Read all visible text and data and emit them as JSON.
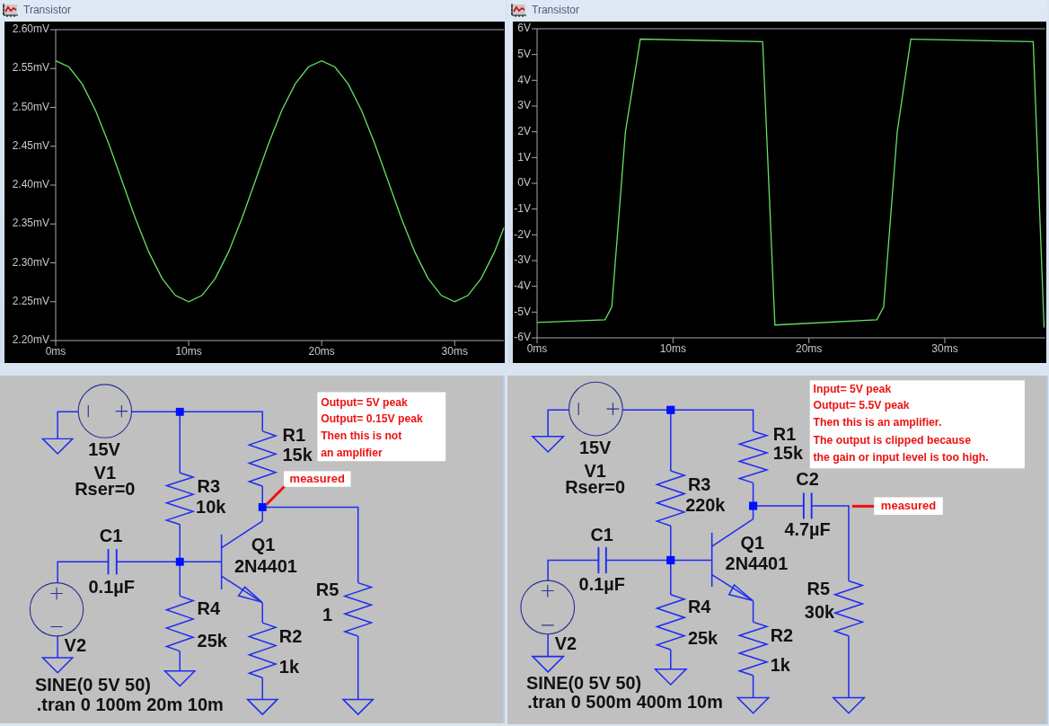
{
  "plot_windows": [
    {
      "title": "Transistor",
      "chart_data": {
        "type": "line",
        "x": [
          0,
          1,
          2,
          3,
          4,
          5,
          6,
          7,
          8,
          9,
          10,
          11,
          12,
          13,
          14,
          15,
          16,
          17,
          18,
          19,
          20,
          21,
          22,
          23,
          24,
          25,
          26,
          27,
          28,
          29,
          30,
          31,
          32,
          33,
          33.7
        ],
        "series": [
          {
            "color": "#66e066",
            "values": [
              2.56,
              2.552,
              2.53,
              2.496,
              2.453,
              2.405,
              2.357,
              2.314,
              2.28,
              2.258,
              2.25,
              2.258,
              2.28,
              2.314,
              2.357,
              2.405,
              2.453,
              2.496,
              2.53,
              2.552,
              2.56,
              2.552,
              2.53,
              2.496,
              2.453,
              2.405,
              2.357,
              2.314,
              2.28,
              2.258,
              2.25,
              2.258,
              2.28,
              2.314,
              2.345
            ]
          }
        ],
        "xlim": [
          0,
          33.7
        ],
        "ylim": [
          2.2,
          2.6
        ],
        "xticks": [
          {
            "value": 0,
            "label": "0ms"
          },
          {
            "value": 10,
            "label": "10ms"
          },
          {
            "value": 20,
            "label": "20ms"
          },
          {
            "value": 30,
            "label": "30ms"
          }
        ],
        "yticks": [
          {
            "value": 2.2,
            "label": "2.20mV"
          },
          {
            "value": 2.25,
            "label": "2.25mV"
          },
          {
            "value": 2.3,
            "label": "2.30mV"
          },
          {
            "value": 2.35,
            "label": "2.35mV"
          },
          {
            "value": 2.4,
            "label": "2.40mV"
          },
          {
            "value": 2.45,
            "label": "2.45mV"
          },
          {
            "value": 2.5,
            "label": "2.50mV"
          },
          {
            "value": 2.55,
            "label": "2.55mV"
          },
          {
            "value": 2.6,
            "label": "2.60mV"
          }
        ]
      }
    },
    {
      "title": "Transistor",
      "chart_data": {
        "type": "line",
        "x": [
          0,
          5,
          5.5,
          6.5,
          7.6,
          16.6,
          17.5,
          25,
          25.5,
          26.5,
          27.5,
          36.5,
          37.3
        ],
        "series": [
          {
            "color": "#66e066",
            "values": [
              -5.4,
              -5.3,
              -4.8,
              2,
              5.6,
              5.5,
              -5.5,
              -5.3,
              -4.8,
              2,
              5.6,
              5.5,
              -5.6
            ]
          }
        ],
        "xlim": [
          0,
          37.4
        ],
        "ylim": [
          -6,
          6
        ],
        "xticks": [
          {
            "value": 0,
            "label": "0ms"
          },
          {
            "value": 10,
            "label": "10ms"
          },
          {
            "value": 20,
            "label": "20ms"
          },
          {
            "value": 30,
            "label": "30ms"
          }
        ],
        "yticks": [
          {
            "value": -6,
            "label": "-6V"
          },
          {
            "value": -5,
            "label": "-5V"
          },
          {
            "value": -4,
            "label": "-4V"
          },
          {
            "value": -3,
            "label": "-3V"
          },
          {
            "value": -2,
            "label": "-2V"
          },
          {
            "value": -1,
            "label": "-1V"
          },
          {
            "value": 0,
            "label": "0V"
          },
          {
            "value": 1,
            "label": "1V"
          },
          {
            "value": 2,
            "label": "2V"
          },
          {
            "value": 3,
            "label": "3V"
          },
          {
            "value": 4,
            "label": "4V"
          },
          {
            "value": 5,
            "label": "5V"
          },
          {
            "value": 6,
            "label": "6V"
          }
        ]
      }
    }
  ],
  "schematics": [
    {
      "labels": [
        "15V",
        "V1",
        "Rser=0",
        "R1",
        "15k",
        "R3",
        "10k",
        "C1",
        "0.1µF",
        "Q1",
        "2N4401",
        "R4",
        "25k",
        "R2",
        "1k",
        "R5",
        "1",
        "V2",
        "SINE(0 5V 50)",
        ".tran 0 100m 20m 10m"
      ],
      "note": [
        "Output= 5V peak",
        "Output= 0.15V peak",
        "Then this is not",
        "an amplifier"
      ],
      "probe_label": "measured"
    },
    {
      "labels": [
        "15V",
        "V1",
        "Rser=0",
        "R1",
        "15k",
        "R3",
        "220k",
        "C2",
        "4.7µF",
        "C1",
        "0.1µF",
        "Q1",
        "2N4401",
        "R4",
        "25k",
        "R2",
        "1k",
        "R5",
        "30k",
        "V2",
        "SINE(0 5V 50)",
        ".tran 0 500m 400m 10m"
      ],
      "note": [
        "Input= 5V peak",
        "Output= 5.5V peak",
        "Then this is an amplifier.",
        "The output is clipped because",
        "the gain or input level is too high."
      ],
      "probe_label": "measured"
    }
  ]
}
